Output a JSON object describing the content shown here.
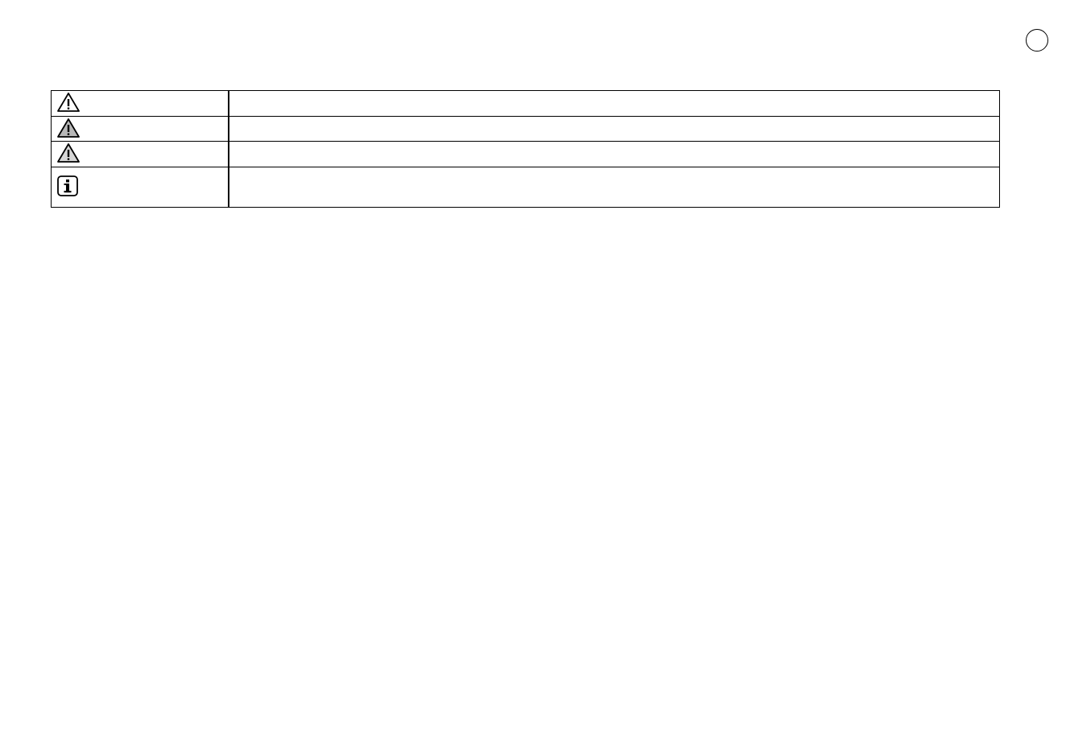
{
  "page_badge": "",
  "symbols": [
    {
      "icon": "warning-triangle-icon",
      "fill": "#ffffff",
      "text": ""
    },
    {
      "icon": "warning-triangle-icon",
      "fill": "#b8b8b8",
      "text": ""
    },
    {
      "icon": "warning-triangle-icon",
      "fill": "#d6d6d6",
      "text": ""
    },
    {
      "icon": "info-icon",
      "fill": "#ffffff",
      "text": ""
    }
  ]
}
